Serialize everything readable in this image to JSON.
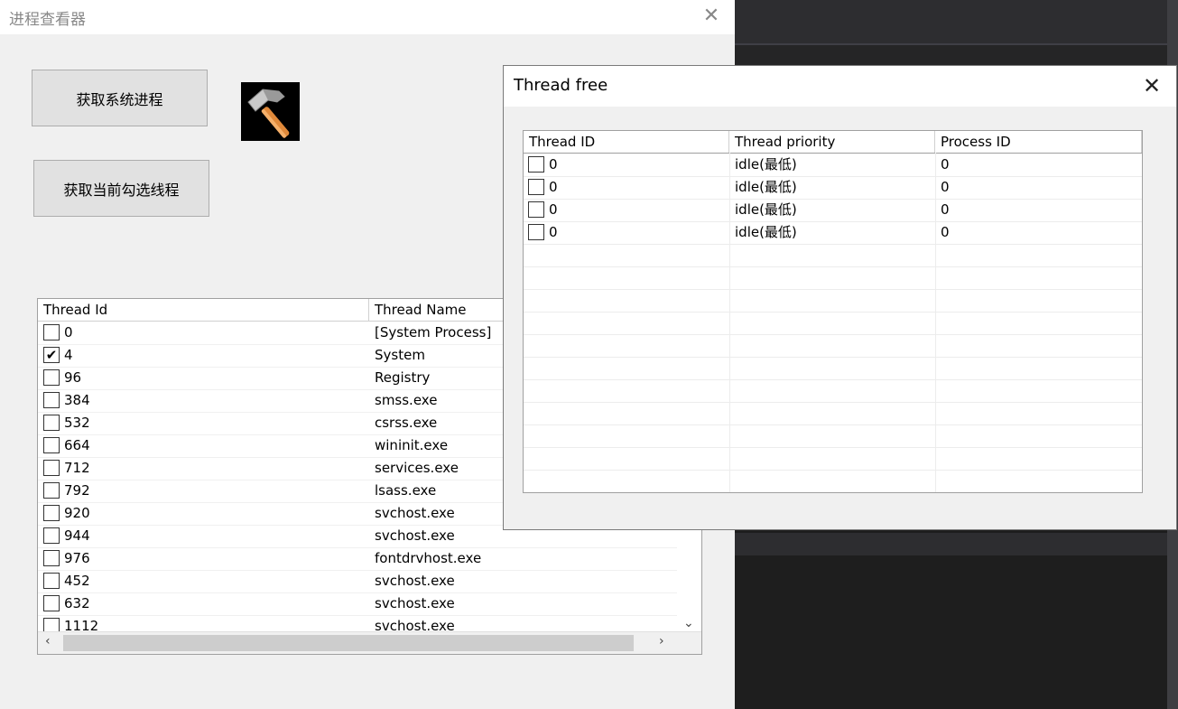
{
  "main_window": {
    "title": "进程查看器",
    "close_glyph": "✕",
    "buttons": {
      "get_system_processes": "获取系统进程",
      "get_selected_threads": "获取当前勾选线程"
    },
    "process_list": {
      "columns": [
        "Thread Id",
        "Thread Name"
      ],
      "rows": [
        {
          "id": "0",
          "name": "[System Process]",
          "checked": false
        },
        {
          "id": "4",
          "name": "System",
          "checked": true
        },
        {
          "id": "96",
          "name": "Registry",
          "checked": false
        },
        {
          "id": "384",
          "name": "smss.exe",
          "checked": false
        },
        {
          "id": "532",
          "name": "csrss.exe",
          "checked": false
        },
        {
          "id": "664",
          "name": "wininit.exe",
          "checked": false
        },
        {
          "id": "712",
          "name": "services.exe",
          "checked": false
        },
        {
          "id": "792",
          "name": "lsass.exe",
          "checked": false
        },
        {
          "id": "920",
          "name": "svchost.exe",
          "checked": false
        },
        {
          "id": "944",
          "name": "svchost.exe",
          "checked": false
        },
        {
          "id": "976",
          "name": "fontdrvhost.exe",
          "checked": false
        },
        {
          "id": "452",
          "name": "svchost.exe",
          "checked": false
        },
        {
          "id": "632",
          "name": "svchost.exe",
          "checked": false
        },
        {
          "id": "1112",
          "name": "svchost.exe",
          "checked": false
        }
      ]
    }
  },
  "thread_dialog": {
    "title": "Thread free",
    "close_glyph": "✕",
    "columns": [
      "Thread ID",
      "Thread priority",
      "Process ID"
    ],
    "rows": [
      {
        "thread_id": "0",
        "priority": "idle(最低)",
        "process_id": "0"
      },
      {
        "thread_id": "0",
        "priority": "idle(最低)",
        "process_id": "0"
      },
      {
        "thread_id": "0",
        "priority": "idle(最低)",
        "process_id": "0"
      },
      {
        "thread_id": "0",
        "priority": "idle(最低)",
        "process_id": "0"
      }
    ]
  },
  "icons": {
    "hammer": "hammer-icon",
    "check": "✔",
    "scroll_down": "⌄",
    "scroll_left": "‹",
    "scroll_right": "›"
  }
}
